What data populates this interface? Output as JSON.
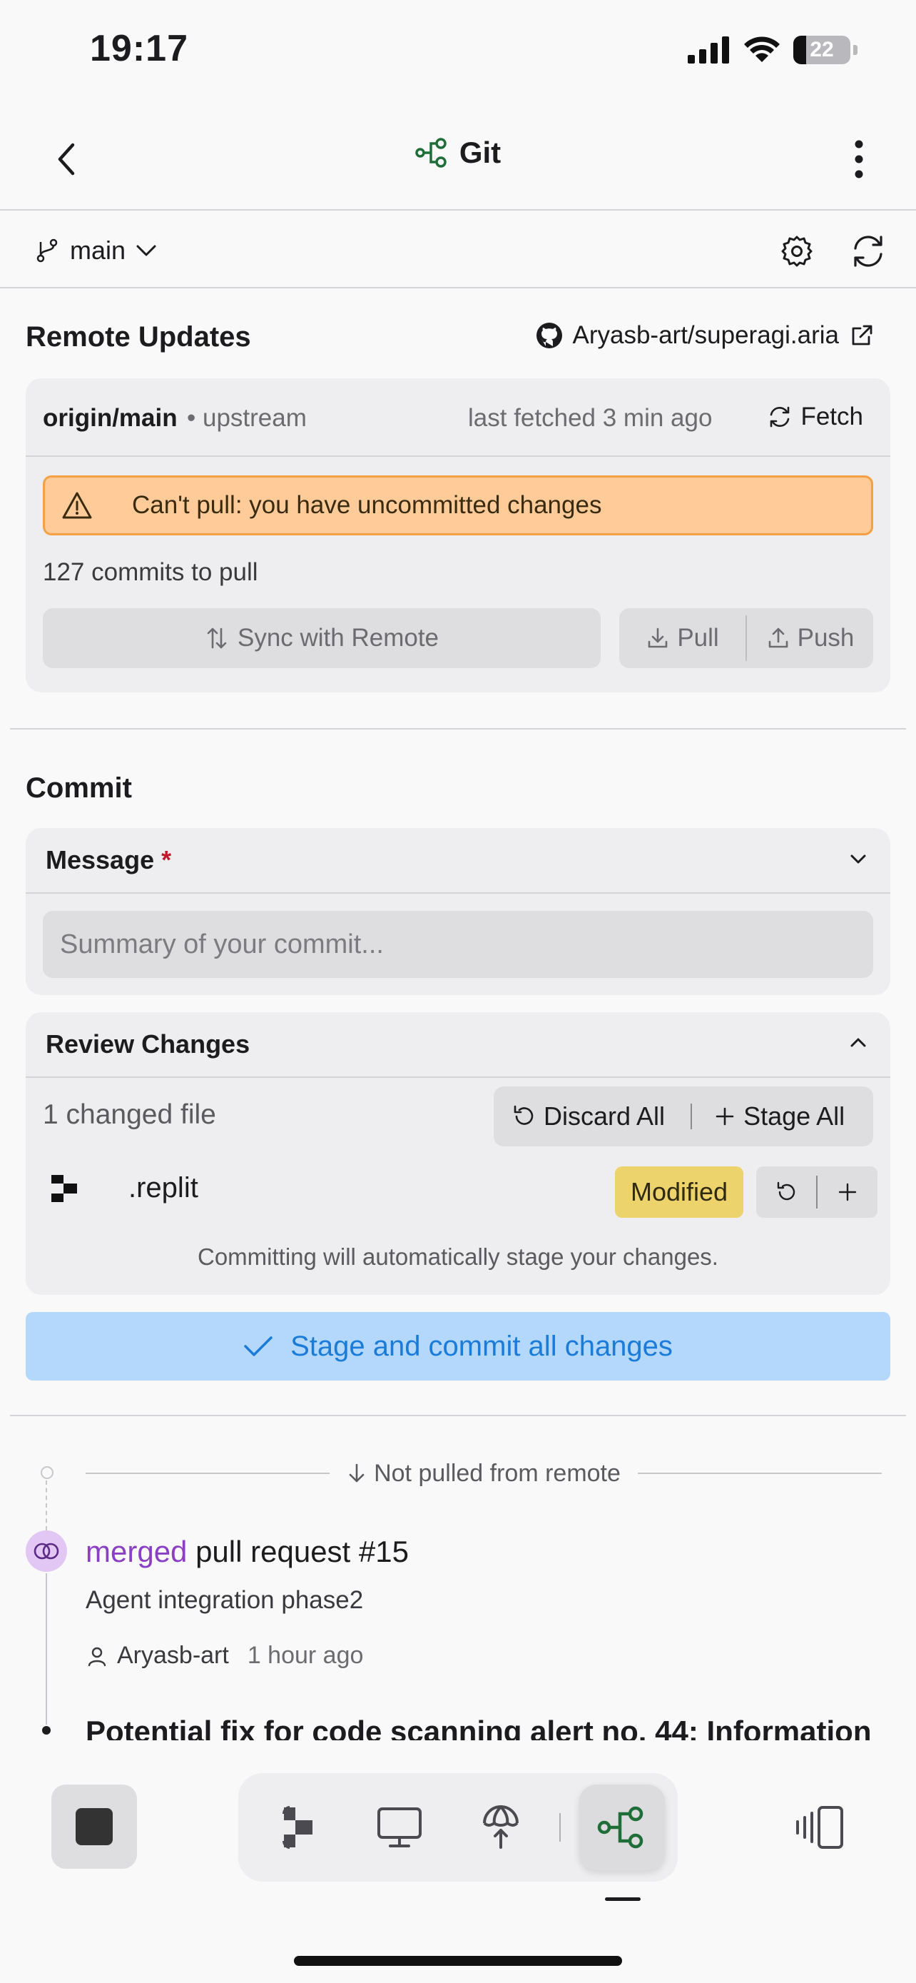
{
  "status_bar": {
    "time": "19:17",
    "battery": "22"
  },
  "header": {
    "title": "Git"
  },
  "branch": {
    "name": "main"
  },
  "remote": {
    "section_title": "Remote Updates",
    "repo": "Aryasb-art/superagi.aria",
    "branch": "origin/main",
    "upstream": "• upstream",
    "last_fetched": "last fetched 3 min ago",
    "fetch_label": "Fetch",
    "warning": "Can't pull: you have uncommitted changes",
    "commits_to_pull": "127 commits to pull",
    "sync_label": "Sync with Remote",
    "pull_label": "Pull",
    "push_label": "Push"
  },
  "commit": {
    "section_title": "Commit",
    "message_label": "Message",
    "required_mark": "*",
    "placeholder": "Summary of your commit...",
    "review_title": "Review Changes",
    "changed_count": "1 changed file",
    "discard_all": "Discard All",
    "stage_all": "Stage All",
    "files": [
      {
        "name": ".replit",
        "status": "Modified"
      }
    ],
    "auto_stage_note": "Committing will automatically stage your changes.",
    "commit_button": "Stage and commit all changes"
  },
  "history": {
    "not_pulled_label": "Not pulled from remote",
    "items": [
      {
        "action": "merged",
        "title_rest": "pull request #15",
        "subtitle": "Agent integration phase2",
        "author": "Aryasb-art",
        "time": "1 hour ago"
      },
      {
        "title": "Potential fix for code scanning alert no. 44: Information"
      }
    ]
  },
  "toolbar": {
    "tools": [
      "agent-icon",
      "console-icon",
      "deploy-icon",
      "git-icon"
    ],
    "active": "git-icon"
  },
  "colors": {
    "accent_green": "#1f6e38",
    "warning_bg": "#ffcc99",
    "warning_border": "#f5a042",
    "commit_button_bg": "#b3d8fc",
    "commit_button_text": "#1b7bd8",
    "merged_purple": "#8a3fc4",
    "modified_badge": "#ecd36c"
  }
}
